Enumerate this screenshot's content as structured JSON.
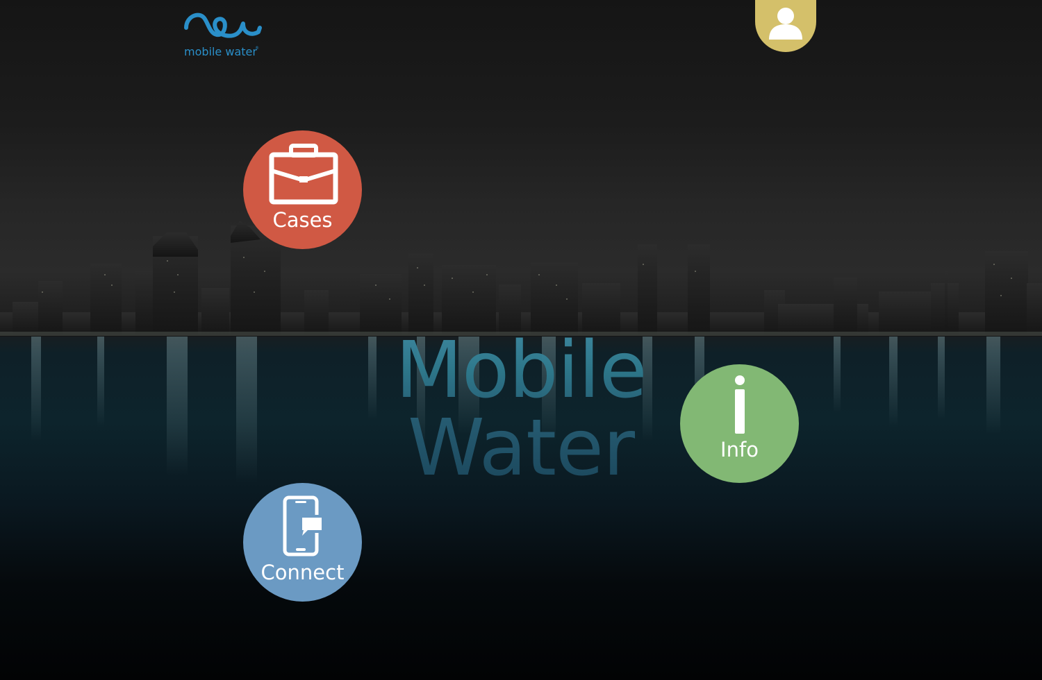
{
  "app": {
    "logo_text": "mobile water",
    "logo_registered": "®",
    "hero_line1": "Mobile",
    "hero_line2": "Water"
  },
  "nav": {
    "cases_label": "Cases",
    "info_label": "Info",
    "connect_label": "Connect"
  },
  "icons": {
    "user": "user-icon",
    "cases": "briefcase-icon",
    "info": "info-icon",
    "connect": "phone-chat-icon",
    "logo": "wave-logo-icon"
  },
  "colors": {
    "logo_blue": "#2a8fc9",
    "user_gold": "#d4c06a",
    "cases_red": "#d05944",
    "info_green": "#82b874",
    "connect_blue": "#6b9ac3"
  }
}
